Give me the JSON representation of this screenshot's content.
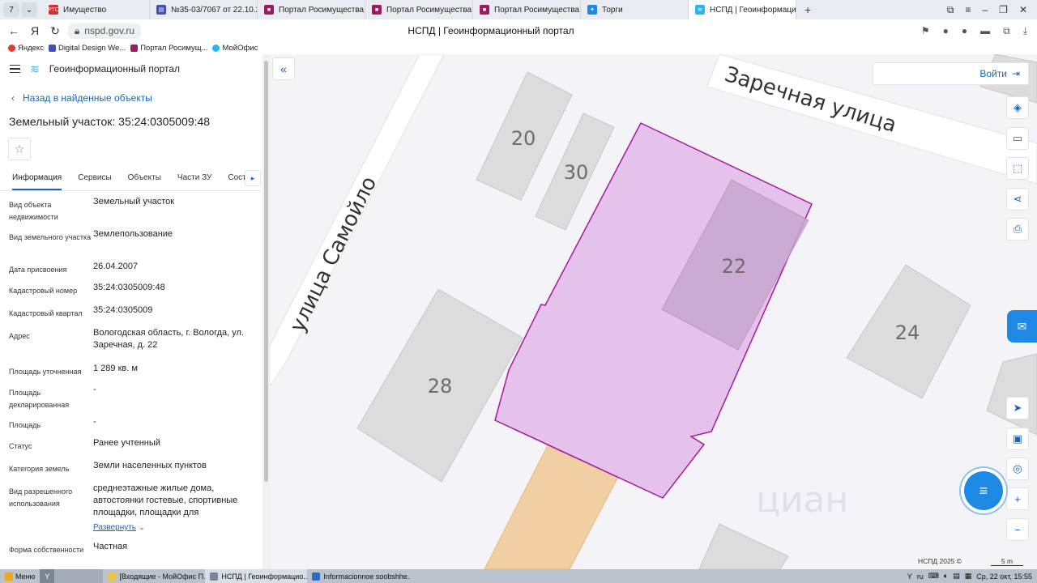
{
  "browser": {
    "tab_counter": "7",
    "tabs": [
      {
        "label": "Имущество",
        "favicon": "РТС"
      },
      {
        "label": "№35-03/7067 от 22.10.25",
        "favicon": "doc"
      },
      {
        "label": "Портал Росимущества",
        "favicon": "rosim"
      },
      {
        "label": "Портал Росимущества",
        "favicon": "rosim"
      },
      {
        "label": "Портал Росимущества",
        "favicon": "rosim"
      },
      {
        "label": "Торги",
        "favicon": "torgi"
      },
      {
        "label": "НСПД | Геоинформаци...",
        "favicon": "nspd",
        "active": true
      }
    ],
    "url": "nspd.gov.ru",
    "page_title": "НСПД | Геоинформационный портал",
    "bookmarks": [
      "Яндекс",
      "Digital Design We...",
      "Портал Росимущ...",
      "МойОфис"
    ]
  },
  "panel": {
    "app_title": "Геоинформационный портал",
    "back_link": "Назад в найденные объекты",
    "title": "Земельный участок: 35:24:0305009:48",
    "tabs": [
      "Информация",
      "Сервисы",
      "Объекты",
      "Части ЗУ",
      "Соста..."
    ],
    "rows": [
      {
        "k": "Вид объекта недвижимости",
        "v": "Земельный участок"
      },
      {
        "k": "Вид земельного участка",
        "v": "Землепользование"
      },
      {
        "k": "Дата присвоения",
        "v": "26.04.2007"
      },
      {
        "k": "Кадастровый номер",
        "v": "35:24:0305009:48"
      },
      {
        "k": "Кадастровый квартал",
        "v": "35:24:0305009"
      },
      {
        "k": "Адрес",
        "v": "Вологодская область, г. Вологда, ул. Заречная, д. 22"
      },
      {
        "k": "Площадь уточненная",
        "v": "1 289 кв. м"
      },
      {
        "k": "Площадь декларированная",
        "v": "-"
      },
      {
        "k": "Площадь",
        "v": "-"
      },
      {
        "k": "Статус",
        "v": "Ранее учтенный"
      },
      {
        "k": "Категория земель",
        "v": "Земли населенных пунктов"
      },
      {
        "k": "Вид разрешенного использования",
        "v": "среднеэтажные жилые дома, автостоянки гостевые, спортивные площадки, площадки для"
      },
      {
        "k": "Форма собственности",
        "v": "Частная"
      }
    ],
    "expand_label": "Развернуть"
  },
  "map": {
    "streets": [
      "Заречная улица",
      "улица Самойло"
    ],
    "house_numbers": [
      "20",
      "30",
      "22",
      "24",
      "28"
    ],
    "login_label": "Войти",
    "attribution": "НСПД 2025 ©",
    "scale": "5 m",
    "watermark": "циан",
    "parcel_color": "#e4c2ec",
    "accent": "#1565c0"
  },
  "taskbar": {
    "start": "Меню",
    "items": [
      "[Входящие - МойОфис П...",
      "НСПД | Геоинформацио...",
      "Informacionnoe soobshhe..."
    ],
    "lang": "ru",
    "clock": "Ср, 22 окт, 15:55"
  }
}
